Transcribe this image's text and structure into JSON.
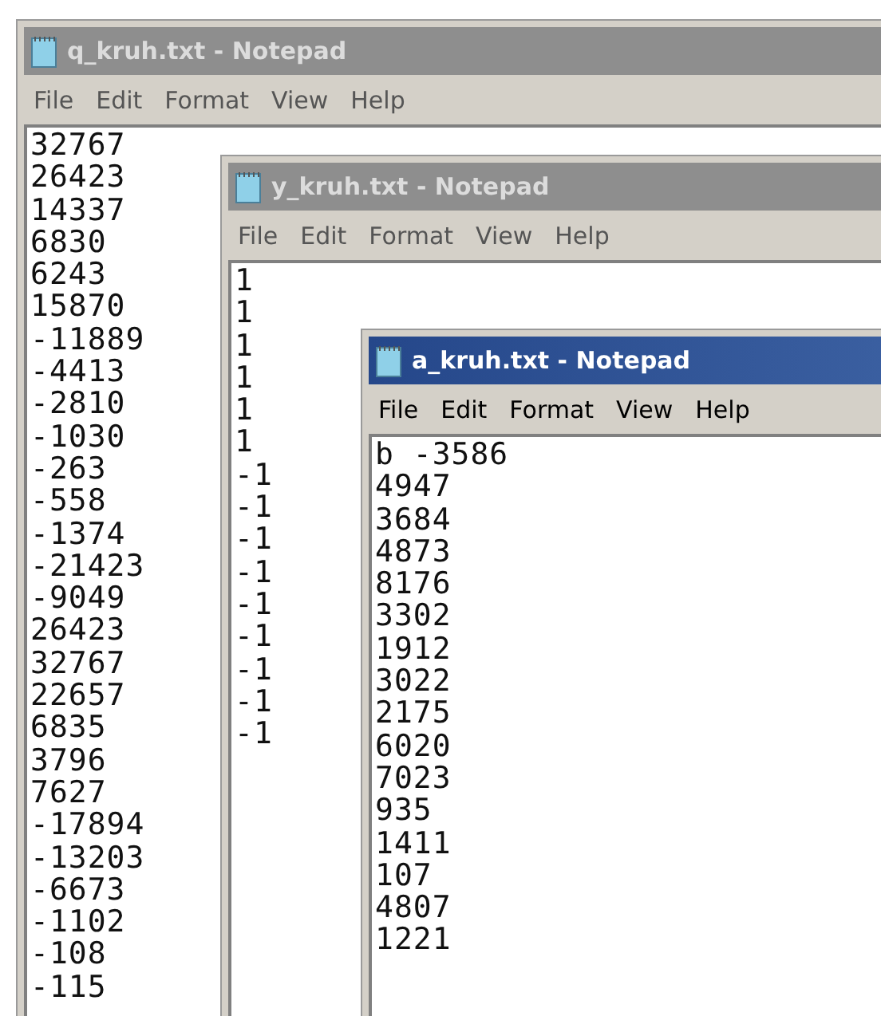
{
  "windows": [
    {
      "title": "q_kruh.txt - Notepad",
      "active": false,
      "menu": [
        "File",
        "Edit",
        "Format",
        "View",
        "Help"
      ],
      "lines": [
        "32767",
        "26423",
        "14337",
        "6830",
        "6243",
        "15870",
        "-11889",
        "-4413",
        "-2810",
        "-1030",
        "-263",
        "-558",
        "-1374",
        "-21423",
        "-9049",
        "26423",
        "32767",
        "22657",
        "6835",
        "3796",
        "7627",
        "-17894",
        "-13203",
        "-6673",
        "-1102",
        "-108",
        "-115"
      ]
    },
    {
      "title": "y_kruh.txt - Notepad",
      "active": false,
      "menu": [
        "File",
        "Edit",
        "Format",
        "View",
        "Help"
      ],
      "lines": [
        "1",
        "1",
        "1",
        "1",
        "1",
        "1",
        "-1",
        "-1",
        "-1",
        "-1",
        "-1",
        "-1",
        "-1",
        "-1",
        "-1"
      ]
    },
    {
      "title": "a_kruh.txt - Notepad",
      "active": true,
      "menu": [
        "File",
        "Edit",
        "Format",
        "View",
        "Help"
      ],
      "lines": [
        "b -3586",
        "4947",
        "3684",
        "4873",
        "8176",
        "3302",
        "1912",
        "3022",
        "2175",
        "6020",
        "7023",
        "935",
        "1411",
        "107",
        "4807",
        "1221"
      ]
    }
  ]
}
